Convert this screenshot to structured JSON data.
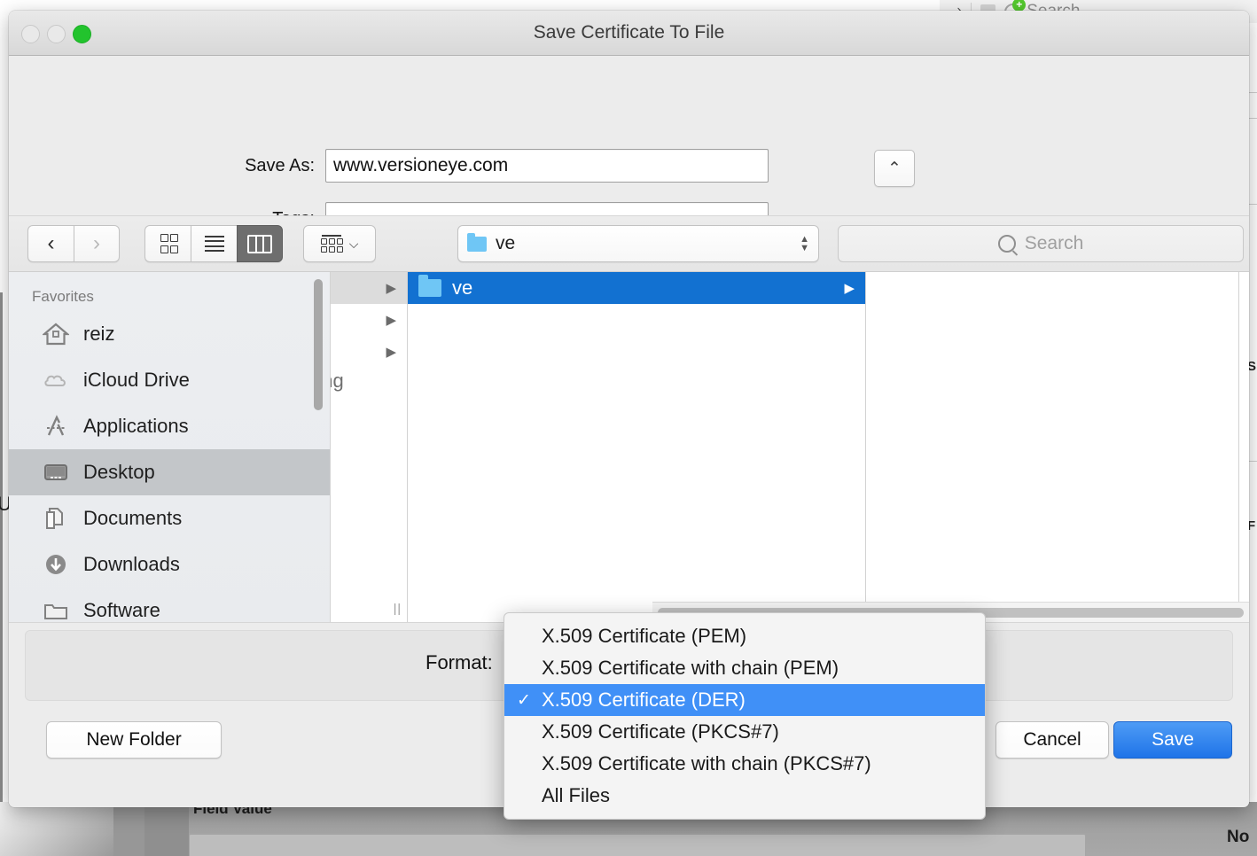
{
  "background_window": {
    "toolbar": {
      "redo_icon": "redo-arrow-icon",
      "search_placeholder": "Search",
      "add_badge": "+"
    },
    "field_value_label": "Field Value",
    "right_text": "No",
    "left_text": "U"
  },
  "sheet": {
    "title": "Save Certificate To File",
    "window_controls": {
      "close": "close-button",
      "minimize": "minimize-button",
      "zoom": "zoom-button"
    },
    "save_as": {
      "label": "Save As:",
      "value": "www.versioneye.com",
      "placeholder": ""
    },
    "tags": {
      "label": "Tags:",
      "value": "",
      "placeholder": ""
    },
    "disclosure": {
      "glyph": "⌃",
      "name": "collapse-chevron-icon"
    },
    "toolbar": {
      "back_glyph": "‹",
      "forward_glyph": "›",
      "views": [
        {
          "name": "icon-view",
          "active": false
        },
        {
          "name": "list-view",
          "active": false
        },
        {
          "name": "column-view",
          "active": true
        }
      ],
      "arrange": {
        "name": "arrange-by-button",
        "chevron": "⌵"
      },
      "path_popup": {
        "folder": "ve",
        "icon": "folder-icon"
      },
      "search": {
        "placeholder": "Search",
        "icon": "search-icon"
      }
    },
    "sidebar": {
      "header": "Favorites",
      "items": [
        {
          "label": "reiz",
          "icon": "home-icon",
          "selected": false
        },
        {
          "label": "iCloud Drive",
          "icon": "cloud-icon",
          "selected": false
        },
        {
          "label": "Applications",
          "icon": "appstore-icon",
          "selected": false
        },
        {
          "label": "Desktop",
          "icon": "desktop-icon",
          "selected": true
        },
        {
          "label": "Documents",
          "icon": "documents-icon",
          "selected": false
        },
        {
          "label": "Downloads",
          "icon": "download-icon",
          "selected": false
        },
        {
          "label": "Software",
          "icon": "folder-icon",
          "selected": false
        }
      ]
    },
    "columns": {
      "col1_rows": [
        {
          "label": "",
          "grey": true,
          "arrow": true
        },
        {
          "label": "",
          "grey": false,
          "arrow": true
        },
        {
          "label": "",
          "grey": false,
          "arrow": true
        }
      ],
      "col1_clipped_text": "ong",
      "col2_rows": [
        {
          "label": "ve",
          "icon": "folder-icon",
          "selected": true,
          "arrow": true
        }
      ],
      "col3_rows": []
    },
    "format": {
      "label": "Format:",
      "selected": "X.509 Certificate (DER)"
    },
    "buttons": {
      "new_folder": "New Folder",
      "cancel": "Cancel",
      "save": "Save"
    }
  },
  "format_menu": {
    "check_glyph": "✓",
    "items": [
      {
        "label": "X.509 Certificate (PEM)",
        "checked": false
      },
      {
        "label": "X.509 Certificate with chain (PEM)",
        "checked": false
      },
      {
        "label": "X.509 Certificate (DER)",
        "checked": true
      },
      {
        "label": "X.509 Certificate (PKCS#7)",
        "checked": false
      },
      {
        "label": "X.509 Certificate with chain (PKCS#7)",
        "checked": false
      },
      {
        "label": "All Files",
        "checked": false
      }
    ]
  },
  "colors": {
    "selection_blue": "#1271d1",
    "menu_highlight_blue": "#4090f7",
    "primary_button_blue": "#1f74e8",
    "zoom_green": "#22c32d",
    "folder_blue": "#6fc6f5",
    "sidebar_selected_grey": "#c3c6c9"
  }
}
